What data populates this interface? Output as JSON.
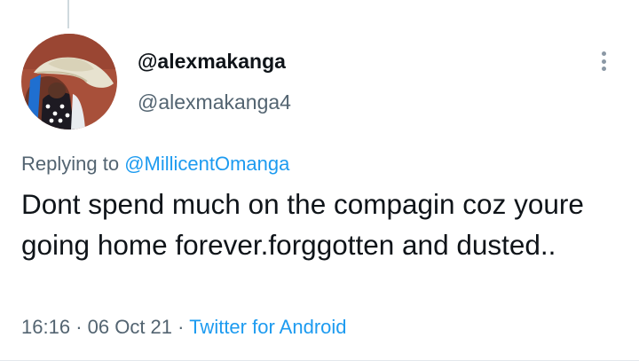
{
  "author": {
    "display_name": "@alexmakanga",
    "handle": "@alexmakanga4",
    "avatar": "profile-photo-child-in-white-hat"
  },
  "reply_context": {
    "prefix": "Replying to",
    "mention": "@MillicentOmanga"
  },
  "tweet": {
    "text": "Dont spend much on the compagin coz youre going home forever.forggotten and dusted.."
  },
  "meta": {
    "time": "16:16",
    "separator": "·",
    "date": "06 Oct 21",
    "source": "Twitter for Android"
  },
  "icons": {
    "more": "more-vertical-icon"
  },
  "colors": {
    "text_primary": "#0f1419",
    "text_secondary": "#536471",
    "link": "#1d9bf0",
    "thread_line": "#cfd9de"
  }
}
